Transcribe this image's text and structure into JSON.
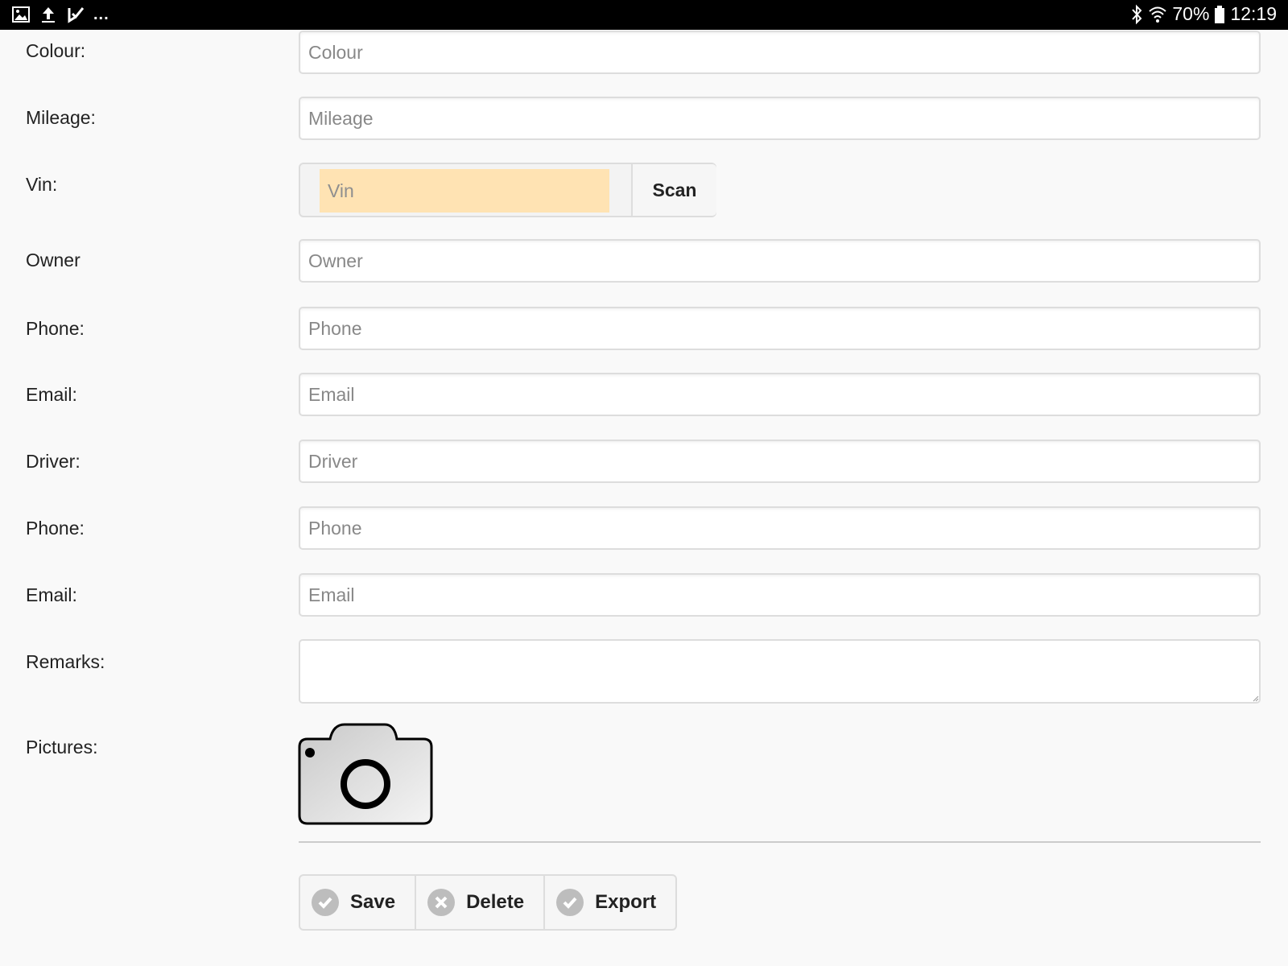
{
  "status_bar": {
    "overflow": "...",
    "battery": "70%",
    "time": "12:19",
    "icons_left": [
      "image-icon",
      "upload-icon",
      "task-check-icon"
    ],
    "icons_right": [
      "bluetooth-icon",
      "wifi-icon",
      "battery-icon"
    ]
  },
  "form": {
    "colour": {
      "label": "Colour:",
      "placeholder": "Colour"
    },
    "mileage": {
      "label": "Mileage:",
      "placeholder": "Mileage"
    },
    "vin": {
      "label": "Vin:",
      "placeholder": "Vin",
      "scan_label": "Scan"
    },
    "owner": {
      "label": "Owner",
      "placeholder": "Owner"
    },
    "owner_phone": {
      "label": "Phone:",
      "placeholder": "Phone"
    },
    "owner_email": {
      "label": "Email:",
      "placeholder": "Email"
    },
    "driver": {
      "label": "Driver:",
      "placeholder": "Driver"
    },
    "driver_phone": {
      "label": "Phone:",
      "placeholder": "Phone"
    },
    "driver_email": {
      "label": "Email:",
      "placeholder": "Email"
    },
    "remarks": {
      "label": "Remarks:",
      "value": ""
    },
    "pictures": {
      "label": "Pictures:"
    }
  },
  "actions": {
    "save": "Save",
    "delete": "Delete",
    "export": "Export"
  },
  "colors": {
    "vin_highlight": "#ffe3b3",
    "background": "#f9f9f9",
    "status_bar": "#000000"
  }
}
